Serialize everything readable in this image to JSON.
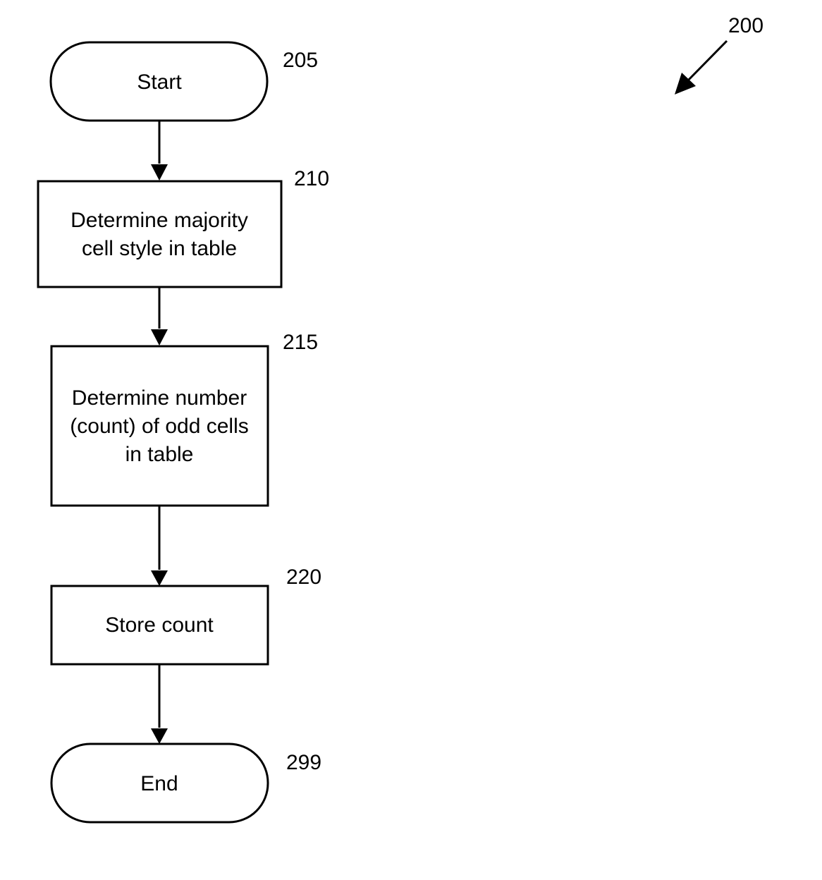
{
  "figure": {
    "reference": "200",
    "nodes": [
      {
        "id": "205",
        "shape": "terminator",
        "lines": [
          "Start"
        ]
      },
      {
        "id": "210",
        "shape": "process",
        "lines": [
          "Determine majority",
          "cell style in table"
        ]
      },
      {
        "id": "215",
        "shape": "process",
        "lines": [
          "Determine number",
          "(count) of odd cells",
          "in table"
        ]
      },
      {
        "id": "220",
        "shape": "process",
        "lines": [
          "Store count"
        ]
      },
      {
        "id": "299",
        "shape": "terminator",
        "lines": [
          "End"
        ]
      }
    ],
    "edges": [
      {
        "from": "205",
        "to": "210"
      },
      {
        "from": "210",
        "to": "215"
      },
      {
        "from": "215",
        "to": "220"
      },
      {
        "from": "220",
        "to": "299"
      }
    ]
  }
}
